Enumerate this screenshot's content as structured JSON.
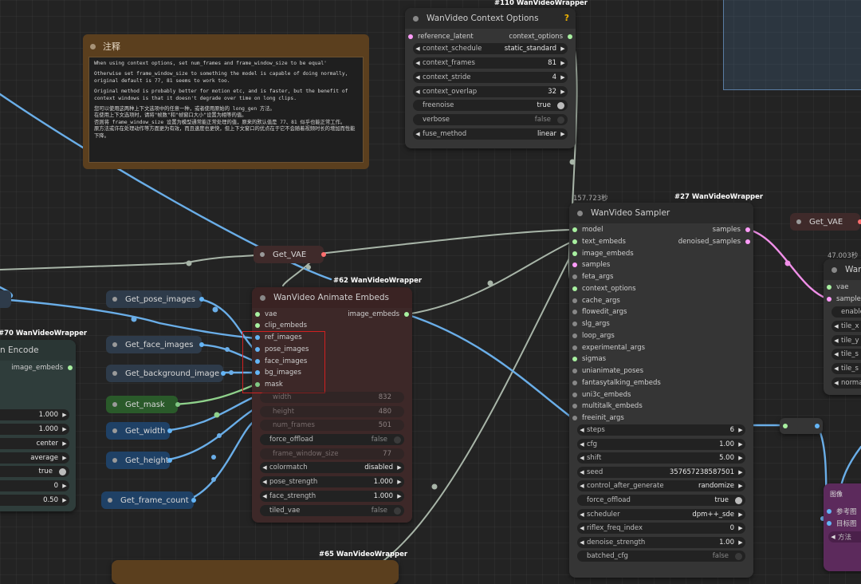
{
  "colors": {
    "latent": "#ff9cf9",
    "model": "#b39ddb",
    "conditioning": "#93c97a",
    "image": "#64b5f6",
    "vae": "#ff6e6e",
    "int": "#7ec8e3",
    "mask": "#81c784"
  },
  "note": {
    "title": "注释",
    "lines": [
      "When using context options, set num_frames and frame_window_size to be equal'",
      "Otherwise set frame_window_size to something the model is capable of doing normally, original default is 77, 81 seems to work too.",
      "Original method is probably better for motion etc, and is faster, but the benefit of context windows is that it doesn't degrade over time on long clips.",
      "您可以使用这两种上下文选项中的任意一种，或者使用原始的 long_gen 方法。\n在使用上下文选项时，请将\"帧数\"和\"帧窗口大小\"设置为相等的值。\n否则将 frame_window_size 设置为模型通常能正常处理的值，原来的默认值是 77、81 似乎也能正常工作。\n原方法或许在处理动作等方面更为有效，而且速度也更快，但上下文窗口的优点在于它不会随着视频时长的增加而性能下降。"
    ]
  },
  "context_node": {
    "badge": "#110 WanVideoWrapper",
    "title": "WanVideo Context Options",
    "help": "?",
    "input": "reference_latent",
    "output": "context_options",
    "widgets": [
      {
        "name": "context_schedule",
        "value": "static_standard"
      },
      {
        "name": "context_frames",
        "value": "81"
      },
      {
        "name": "context_stride",
        "value": "4"
      },
      {
        "name": "context_overlap",
        "value": "32"
      },
      {
        "name": "freenoise",
        "value": "true"
      },
      {
        "name": "verbose",
        "value": "false"
      },
      {
        "name": "fuse_method",
        "value": "linear"
      }
    ]
  },
  "sampler": {
    "badge": "#27 WanVideoWrapper",
    "time": "157.723秒",
    "title": "WanVideo Sampler",
    "inputs": [
      "model",
      "text_embeds",
      "image_embeds",
      "samples",
      "feta_args",
      "context_options",
      "cache_args",
      "flowedit_args",
      "slg_args",
      "loop_args",
      "experimental_args",
      "sigmas",
      "unianimate_poses",
      "fantasytalking_embeds",
      "uni3c_embeds",
      "multitalk_embeds",
      "freeinit_args"
    ],
    "outputs": [
      "samples",
      "denoised_samples"
    ],
    "widgets": [
      {
        "name": "steps",
        "value": "6"
      },
      {
        "name": "cfg",
        "value": "1.00"
      },
      {
        "name": "shift",
        "value": "5.00"
      },
      {
        "name": "seed",
        "value": "357657238587501"
      },
      {
        "name": "control_after_generate",
        "value": "randomize"
      },
      {
        "name": "force_offload",
        "value": "true"
      },
      {
        "name": "scheduler",
        "value": "dpm++_sde"
      },
      {
        "name": "riflex_freq_index",
        "value": "0"
      },
      {
        "name": "denoise_strength",
        "value": "1.00"
      },
      {
        "name": "batched_cfg",
        "value": "false"
      }
    ]
  },
  "animate": {
    "badge": "#62 WanVideoWrapper",
    "title": "WanVideo Animate Embeds",
    "inputs": [
      "vae",
      "clip_embeds",
      "ref_images",
      "pose_images",
      "face_images",
      "bg_images",
      "mask"
    ],
    "output": "image_embeds",
    "widgets": [
      {
        "name": "width",
        "value": "832"
      },
      {
        "name": "height",
        "value": "480"
      },
      {
        "name": "num_frames",
        "value": "501"
      },
      {
        "name": "force_offload",
        "value": "false"
      },
      {
        "name": "frame_window_size",
        "value": "77"
      },
      {
        "name": "colormatch",
        "value": "disabled"
      },
      {
        "name": "pose_strength",
        "value": "1.000"
      },
      {
        "name": "face_strength",
        "value": "1.000"
      },
      {
        "name": "tiled_vae",
        "value": "false"
      }
    ]
  },
  "encode": {
    "badge": "#70 WanVideoWrapper",
    "title": "n Encode",
    "output": "image_embeds",
    "values": [
      "1.000",
      "1.000",
      "center",
      "average",
      "true",
      "0",
      "0.50"
    ]
  },
  "getters": {
    "get_vae": "Get_VAE",
    "pose": "Get_pose_images",
    "face": "Get_face_images",
    "bg": "Get_background_image",
    "mask": "Get_mask",
    "width": "Get_width",
    "height": "Get_height",
    "frame_count": "Get_frame_count",
    "get_vae_right": "Get_VAE",
    "left_partial": "e"
  },
  "right_node": {
    "time": "47.003秒",
    "title": "Wan",
    "inputs": [
      "vae",
      "samples"
    ],
    "widgets": [
      "enable",
      "tile_x",
      "tile_y",
      "tile_s",
      "tile_s",
      "norma"
    ]
  },
  "bottom_badge": "#65 WanVideoWrapper",
  "pink_node": {
    "lines": [
      "图像",
      "参考图",
      "目标图",
      "方法"
    ]
  }
}
